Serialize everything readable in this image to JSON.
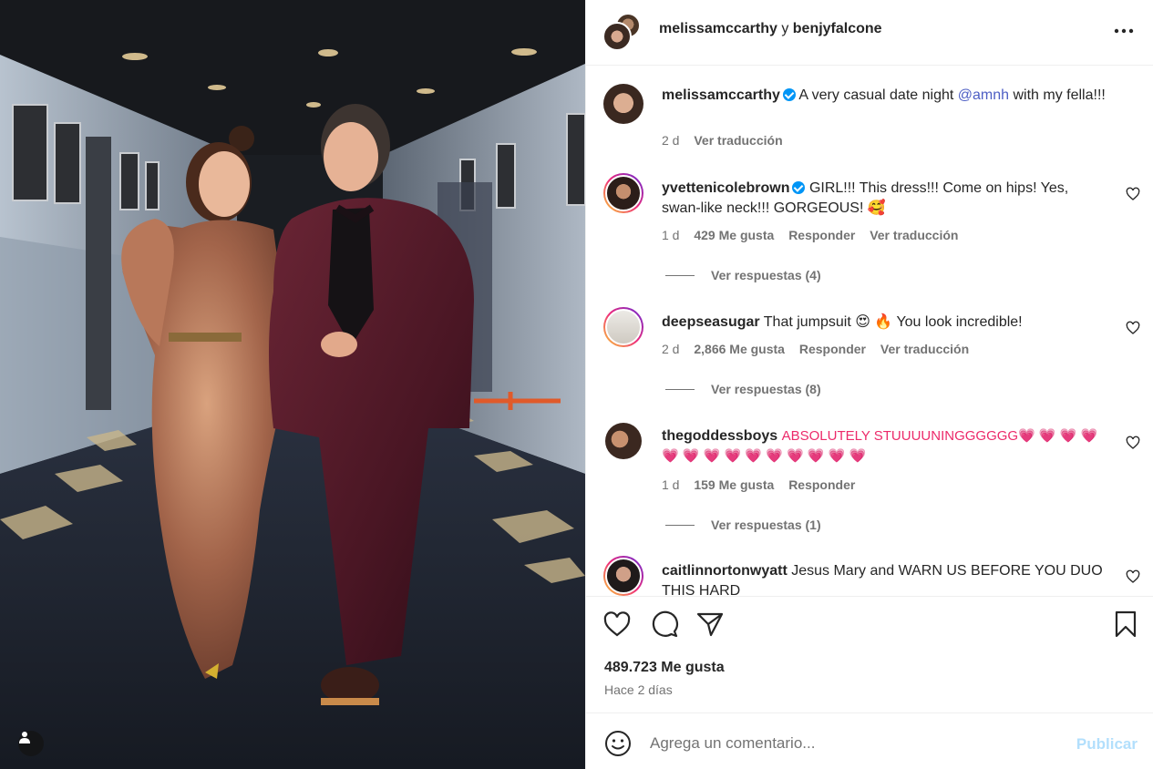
{
  "post": {
    "header": {
      "author1": "melissamccarthy",
      "joiner": "y",
      "author2": "benjyfalcone"
    },
    "caption": {
      "user": "melissamccarthy",
      "text_before": "A very casual date night",
      "mention": "@amnh",
      "text_after": "with my fella!!!",
      "time": "2 d",
      "translate": "Ver traducción"
    },
    "comments": [
      {
        "user": "yvettenicolebrown",
        "text": "GIRL!!! This dress!!! Come on hips! Yes, swan-like neck!!! GORGEOUS! 🥰",
        "time": "1 d",
        "likes": "429 Me gusta",
        "reply": "Responder",
        "translate": "Ver traducción",
        "replies": "Ver respuestas (4)"
      },
      {
        "user": "deepseasugar",
        "text": "That jumpsuit 😍 🔥  You look incredible!",
        "time": "2 d",
        "likes": "2,866 Me gusta",
        "reply": "Responder",
        "translate": "Ver traducción",
        "replies": "Ver respuestas (8)"
      },
      {
        "user": "thegoddessboys",
        "text": "ABSOLUTELY STUUUUNINGGGGGG💗 💗 💗 💗 💗 💗 💗 💗 💗 💗 💗 💗 💗 💗",
        "time": "1 d",
        "likes": "159 Me gusta",
        "reply": "Responder",
        "replies": "Ver respuestas (1)"
      },
      {
        "user": "caitlinnortonwyatt",
        "text": "Jesus Mary and WARN US BEFORE YOU DUO THIS HARD"
      }
    ],
    "likes": "489.723 Me gusta",
    "posted": "Hace 2 días",
    "comment_placeholder": "Agrega un comentario...",
    "publish": "Publicar"
  },
  "icons": {
    "like": "heart-icon",
    "comment": "comment-icon",
    "share": "send-icon",
    "save": "bookmark-icon",
    "more": "more-icon",
    "emoji": "emoji-icon",
    "tags": "user-tag-icon"
  },
  "colors": {
    "link": "#4d5ec4",
    "verified": "#0095f6",
    "publish_disabled": "#b2dffc",
    "secondary_text": "#737373"
  }
}
